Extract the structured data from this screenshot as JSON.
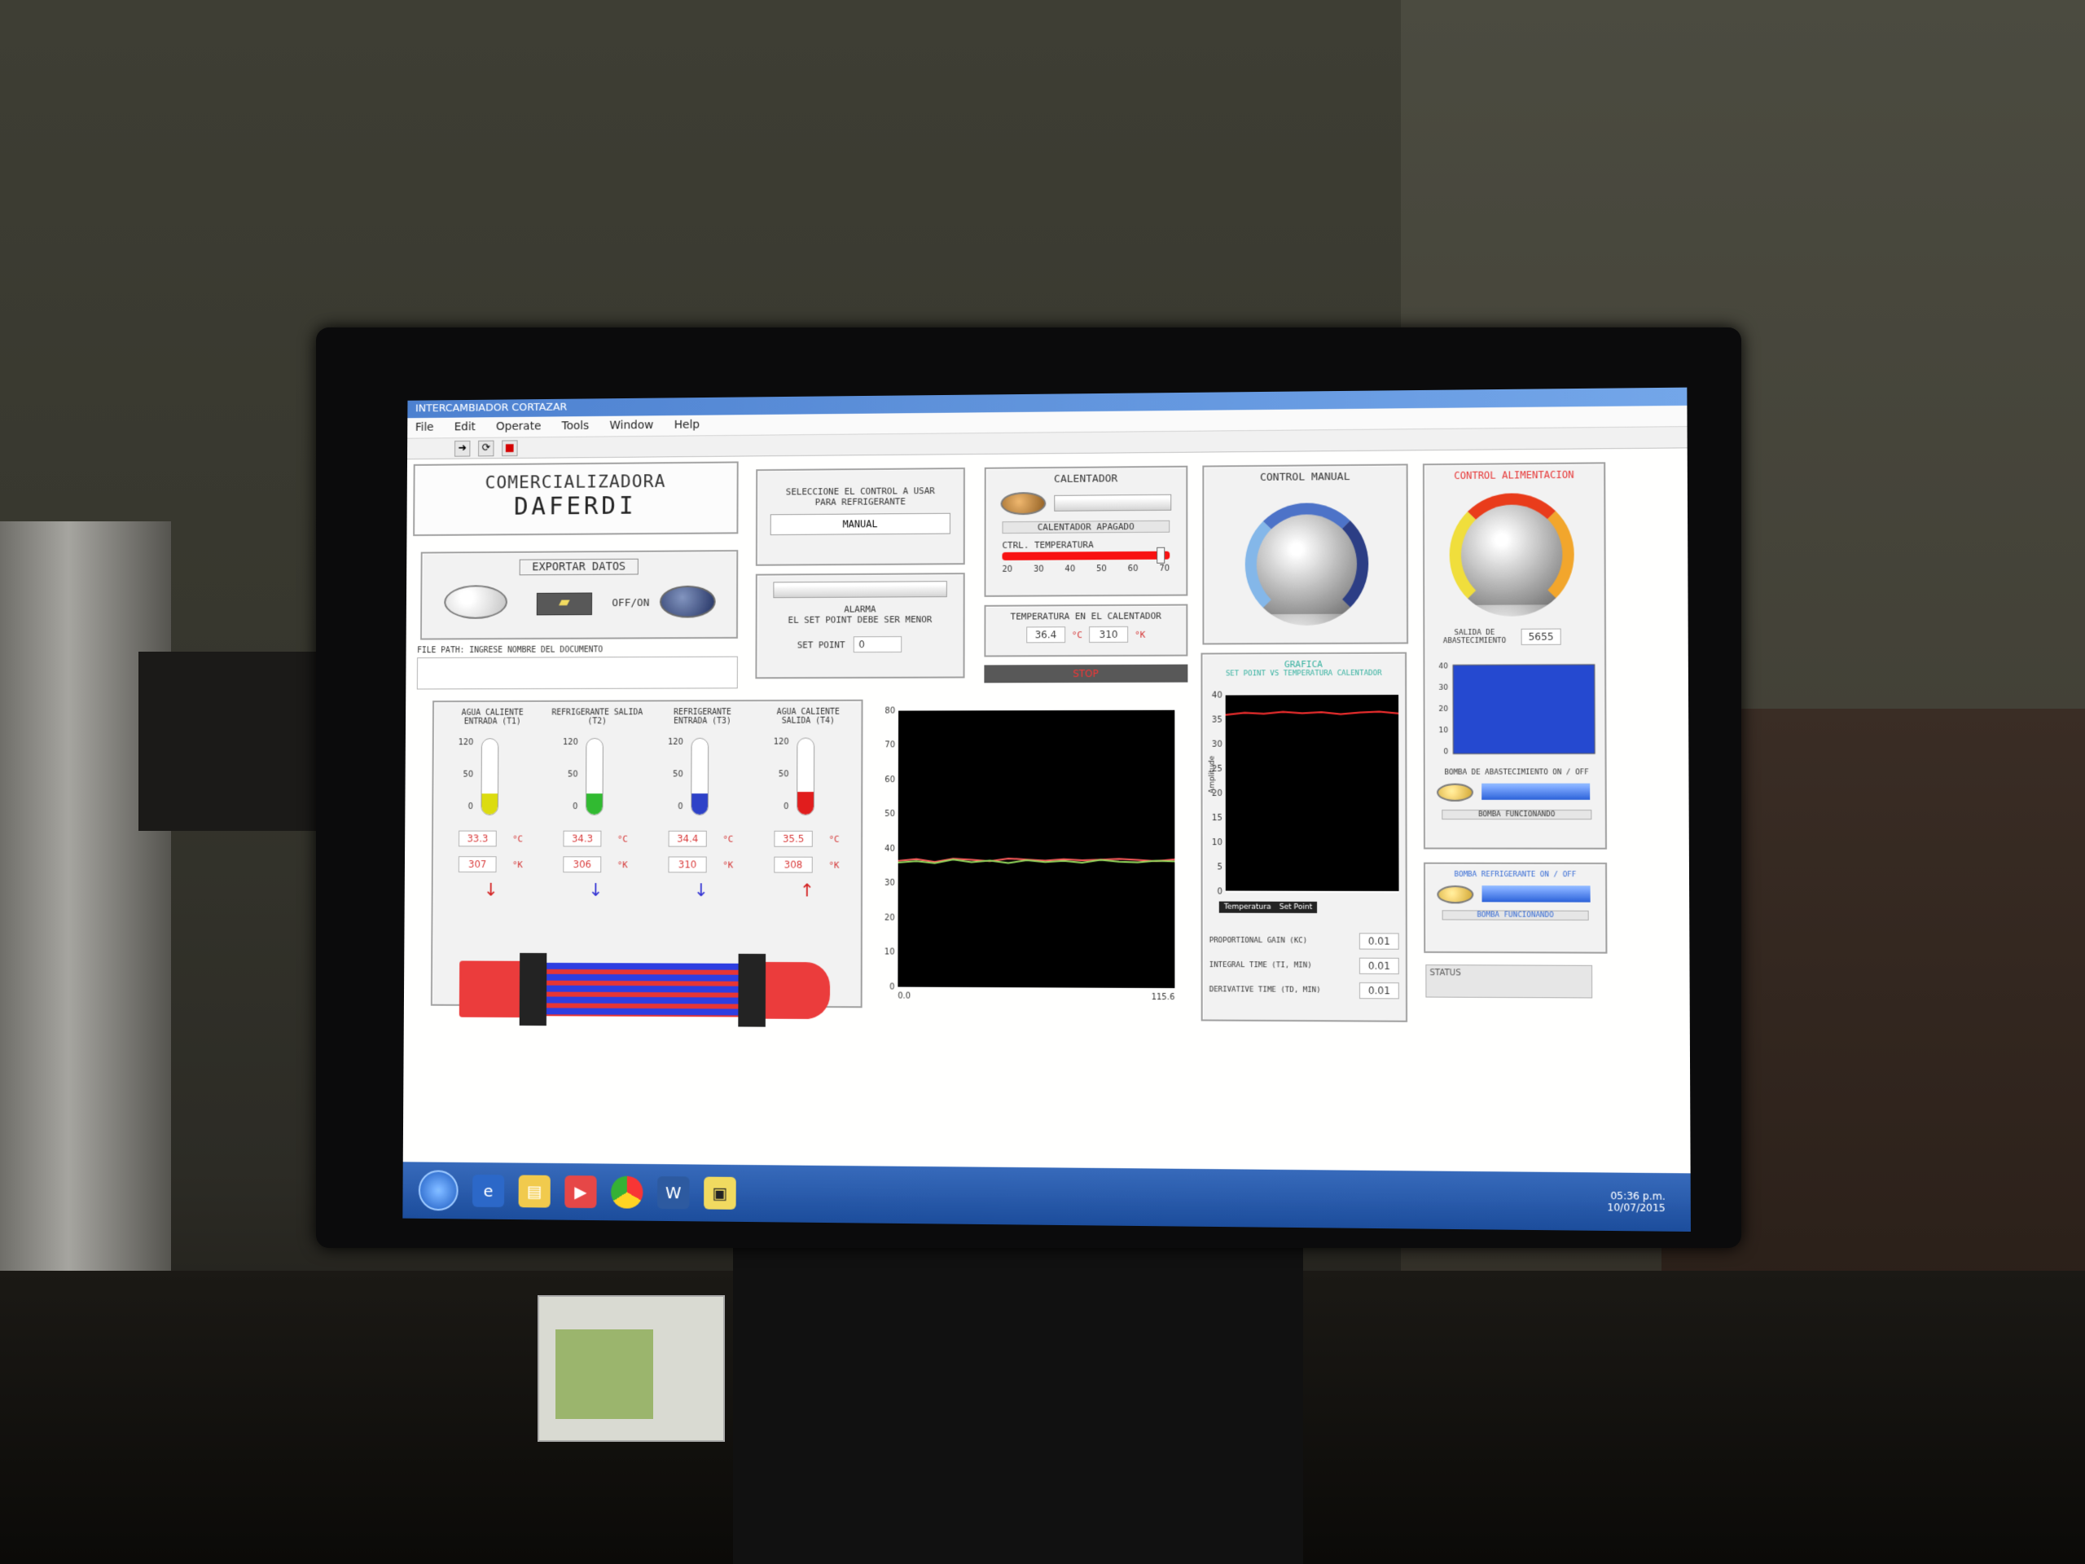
{
  "window": {
    "title": "INTERCAMBIADOR CORTAZAR"
  },
  "menu": [
    "File",
    "Edit",
    "Operate",
    "Tools",
    "Window",
    "Help"
  ],
  "brand": {
    "line1": "COMERCIALIZADORA",
    "line2": "DAFERDI"
  },
  "export": {
    "title": "EXPORTAR DATOS",
    "toggle_label": "OFF/ON",
    "file_path_label": "FILE PATH: INGRESE NOMBRE DEL DOCUMENTO"
  },
  "control_select": {
    "label": "SELECCIONE EL CONTROL A USAR PARA REFRIGERANTE",
    "value": "MANUAL"
  },
  "alarm": {
    "title": "ALARMA",
    "message": "EL SET POINT DEBE SER MENOR",
    "setpoint_label": "SET POINT",
    "setpoint_value": "0"
  },
  "heater": {
    "title": "CALENTADOR",
    "status": "CALENTADOR APAGADO",
    "slider_label": "CTRL. TEMPERATURA",
    "slider_ticks": [
      "20",
      "30",
      "40",
      "50",
      "60",
      "70"
    ],
    "slider_fraction": 0.92
  },
  "heater_temp": {
    "title": "TEMPERATURA EN EL CALENTADOR",
    "celsius": "36.4",
    "celsius_unit": "°C",
    "kelvin": "310",
    "kelvin_unit": "°K",
    "stop_label": "STOP"
  },
  "manual_control": {
    "title": "CONTROL MANUAL"
  },
  "feed_control": {
    "title": "CONTROL ALIMENTACION",
    "pump_label": "SALIDA DE ABASTECIMIENTO",
    "pump_value": "5655",
    "pump1_label": "BOMBA DE ABASTECIMIENTO ON / OFF",
    "pump1_status": "BOMBA FUNCIONANDO",
    "pump2_label": "BOMBA REFRIGERANTE ON / OFF",
    "pump2_status": "BOMBA FUNCIONANDO",
    "status_label": "STATUS"
  },
  "thermometers": [
    {
      "title": "AGUA CALIENTE ENTRADA (T1)",
      "scale": [
        "120",
        "50",
        "0"
      ],
      "celsius": "33.3",
      "kelvin": "307",
      "color": "#d4d40f",
      "level": 0.28
    },
    {
      "title": "REFRIGERANTE SALIDA (T2)",
      "scale": [
        "120",
        "50",
        "0"
      ],
      "celsius": "34.3",
      "kelvin": "306",
      "color": "#2fb32f",
      "level": 0.28
    },
    {
      "title": "REFRIGERANTE ENTRADA (T3)",
      "scale": [
        "120",
        "50",
        "0"
      ],
      "celsius": "34.4",
      "kelvin": "310",
      "color": "#2c3fc0",
      "level": 0.28
    },
    {
      "title": "AGUA CALIENTE SALIDA (T4)",
      "scale": [
        "120",
        "50",
        "0"
      ],
      "celsius": "35.5",
      "kelvin": "308",
      "color": "#d81c1c",
      "level": 0.3
    }
  ],
  "units": {
    "c": "°C",
    "k": "°K"
  },
  "pid": {
    "graph_title": "GRAFICA",
    "graph_subtitle": "SET POINT VS TEMPERATURA CALENTADOR",
    "y_label": "Amplitude",
    "legend": [
      "Temperatura",
      "Set Point"
    ],
    "proportional_label": "PROPORTIONAL GAIN (KC)",
    "proportional_value": "0.01",
    "integral_label": "INTEGRAL TIME (TI, MIN)",
    "integral_value": "0.01",
    "derivative_label": "DERIVATIVE TIME (TD, MIN)",
    "derivative_value": "0.01"
  },
  "taskbar": {
    "time": "05:36 p.m.",
    "date": "10/07/2015"
  },
  "chart_data": [
    {
      "type": "line",
      "ylim": [
        0,
        80
      ],
      "xlim": [
        0,
        115.6
      ],
      "y_ticks": [
        "80",
        "70",
        "60",
        "50",
        "40",
        "30",
        "20",
        "10",
        "0"
      ],
      "x_ticks": [
        "0.0",
        "115.6"
      ],
      "series": [
        {
          "name": "",
          "color": "#ff5a5a",
          "values": [
            36.5,
            37,
            36.2,
            37.1,
            36.8,
            36.4,
            37.2,
            36.9,
            36.6,
            37,
            36.7,
            36.9,
            37.1,
            36.8,
            36.5,
            37
          ]
        },
        {
          "name": "",
          "color": "#8fd45a",
          "values": [
            36,
            36.4,
            35.8,
            36.9,
            36.1,
            36.6,
            35.9,
            36.7,
            36.2,
            36.5,
            36,
            36.8,
            36.3,
            36.1,
            36.6,
            36.4
          ]
        }
      ]
    },
    {
      "type": "line",
      "ylim": [
        0,
        40
      ],
      "y_ticks": [
        "40",
        "35",
        "30",
        "25",
        "20",
        "15",
        "10",
        "5",
        "0"
      ],
      "series": [
        {
          "name": "Temperatura",
          "color": "#ff3030",
          "values": [
            36,
            36.4,
            36.2,
            36.6,
            36.3,
            36.5,
            36.1,
            36.4,
            36.6,
            36.2
          ]
        },
        {
          "name": "Set Point",
          "color": "#ffffff",
          "values": [
            0,
            0,
            0,
            0,
            0,
            0,
            0,
            0,
            0,
            0
          ]
        }
      ]
    },
    {
      "type": "heatmap",
      "ylim": [
        0,
        40
      ],
      "y_ticks": [
        "40",
        "30",
        "20",
        "10",
        "0"
      ]
    }
  ]
}
